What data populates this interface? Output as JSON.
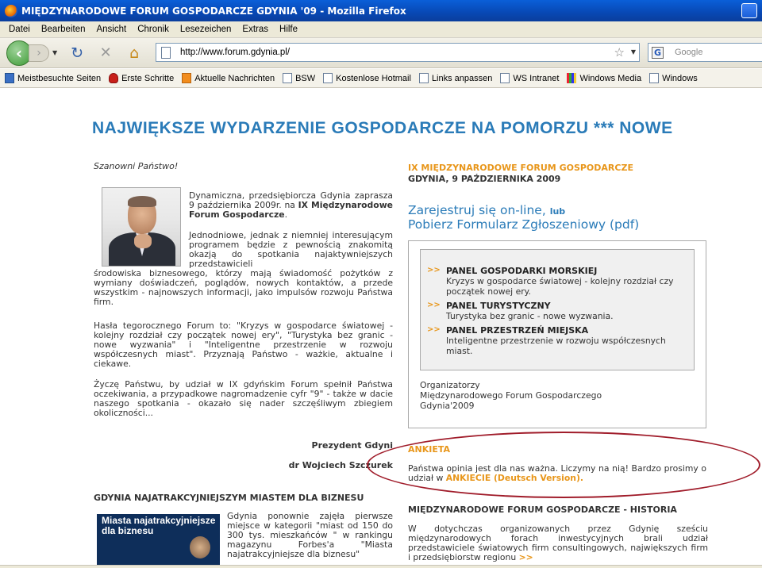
{
  "window": {
    "title": "MIĘDZYNARODOWE FORUM GOSPODARCZE GDYNIA '09 - Mozilla Firefox"
  },
  "menu": [
    "Datei",
    "Bearbeiten",
    "Ansicht",
    "Chronik",
    "Lesezeichen",
    "Extras",
    "Hilfe"
  ],
  "navigation": {
    "back_icon": "back-arrow-icon",
    "forward_icon": "forward-arrow-icon",
    "reload_icon": "reload-icon",
    "stop_icon": "stop-icon",
    "home_icon": "home-icon",
    "url": "http://www.forum.gdynia.pl/",
    "search_placeholder": "Google"
  },
  "bookmarks": [
    "Meistbesuchte Seiten",
    "Erste Schritte",
    "Aktuelle Nachrichten",
    "BSW",
    "Kostenlose Hotmail",
    "Links anpassen",
    "WS Intranet",
    "Windows Media",
    "Windows"
  ],
  "page": {
    "banner": "NAJWIĘKSZE WYDARZENIE GOSPODARCZE NA POMORZU *** NOWE",
    "greeting": "Szanowni Państwo!",
    "intro_1a": "Dynamiczna, przedsiębiorcza Gdynia zaprasza 9 października 2009r. na ",
    "intro_1b": "IX Międzynarodowe Forum Gospodarcze",
    "intro_1c": ".",
    "intro_2a": "Jednodniowe, jednak z niemniej interesującym programem będzie z pewnością znakomitą okazją do spotkania najaktywniejszych przedstawicieli",
    "intro_2b": "środowiska biznesowego, którzy mają świadomość pożytków z wymiany doświadczeń, poglądów, nowych kontaktów, a przede wszystkim - najnowszych informacji, jako impulsów rozwoju Państwa firm.",
    "intro_3": "Hasła tegorocznego Forum to: \"Kryzys w gospodarce światowej - kolejny rozdział czy początek nowej ery\", \"Turystyka bez granic - nowe wyzwania\" i \"Inteligentne przestrzenie w rozwoju współczesnych miast\". Przyznają Państwo - ważkie, aktualne i ciekawe.",
    "intro_4": "Życzę Państwu, by udział w IX gdyńskim Forum spełnił Państwa oczekiwania, a przypadkowe nagromadzenie cyfr \"9\" - także w dacie naszego spotkania - okazało się nader szczęśliwym zbiegiem okoliczności...",
    "signature_title": "Prezydent Gdyni",
    "signature_name": "dr Wojciech Szczurek",
    "gdynia_heading": "GDYNIA NAJATRAKCYJNIEJSZYM MIASTEM DLA BIZNESU",
    "gdynia_image_label": "Miasta najatrakcyjniejsze dla biznesu",
    "gdynia_text": "Gdynia ponownie zajęła pierwsze miejsce w kategorii \"miast od 150 do 300 tys. mieszkańców \" w rankingu magazynu Forbes'a \"Miasta najatrakcyjniejsze dla biznesu\"",
    "event_title": "IX MIĘDZYNARODOWE FORUM GOSPODARCZE",
    "event_date": "GDYNIA, 9 PAŹDZIERNIKA 2009",
    "register_link": "Zarejestruj się on-line,",
    "register_or": "lub",
    "form_link": "Pobierz Formularz Zgłoszeniowy (pdf)",
    "panels": [
      {
        "title": "PANEL GOSPODARKI MORSKIEJ",
        "desc": "Kryzys w gospodarce światowej - kolejny rozdział czy początek nowej ery."
      },
      {
        "title": "PANEL TURYSTYCZNY",
        "desc": "Turystyka bez granic - nowe wyzwania."
      },
      {
        "title": "PANEL PRZESTRZEŃ MIEJSKA",
        "desc": "Inteligentne przestrzenie w rozwoju współczesnych miast."
      }
    ],
    "panel_bullet": ">>",
    "organizers_1": "Organizatorzy",
    "organizers_2": "Międzynarodowego Forum Gospodarczego",
    "organizers_3": "Gdynia'2009",
    "survey_heading": "ANKIETA",
    "survey_text": "Państwa opinia jest dla nas ważna. Liczymy na nią! Bardzo prosimy o udział w ",
    "survey_link": "ANKIECIE (Deutsch Version).",
    "history_heading": "MIĘDZYNARODOWE FORUM GOSPODARCZE - HISTORIA",
    "history_text": "W dotychczas organizowanych przez Gdynię sześciu międzynarodowych forach inwestycyjnych brali udział przedstawiciele światowych firm consultingowych, największych firm i przedsiębiorstw regionu ",
    "history_more": ">>"
  },
  "colors": {
    "accent_blue": "#2a7bb8",
    "accent_orange": "#e8961a",
    "annotation_red": "#a01c2a"
  }
}
